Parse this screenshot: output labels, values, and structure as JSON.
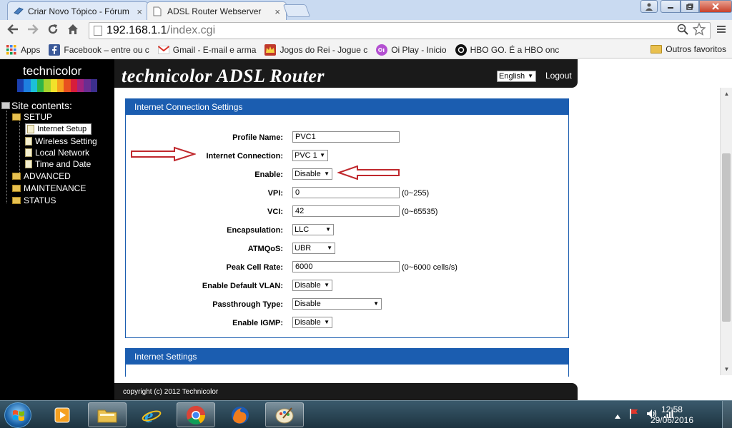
{
  "browser": {
    "tabs": [
      {
        "title": "Criar Novo Tópico - Fórum",
        "active": false
      },
      {
        "title": "ADSL Router Webserver",
        "active": true
      }
    ],
    "close_glyph": "×",
    "address": {
      "host": "192.168.1.1",
      "path": "/index.cgi"
    },
    "bookmarks": [
      {
        "label": "Apps",
        "icon": "apps-grid-icon"
      },
      {
        "label": "Facebook – entre ou c",
        "icon": "facebook-icon"
      },
      {
        "label": "Gmail - E-mail e arma",
        "icon": "gmail-icon"
      },
      {
        "label": "Jogos do Rei - Jogue c",
        "icon": "crown-icon"
      },
      {
        "label": "Oi Play - Inicio",
        "icon": "oi-icon"
      },
      {
        "label": "HBO GO. É a HBO onc",
        "icon": "hbo-icon"
      }
    ],
    "other_bookmarks": "Outros favoritos"
  },
  "router": {
    "logo": "technicolor",
    "brand": "technicolor ADSL Router",
    "language": "English",
    "logout": "Logout",
    "site_contents": "Site contents:",
    "tree": [
      {
        "label": "SETUP",
        "kind": "folder",
        "level": 0
      },
      {
        "label": "Internet Setup",
        "kind": "doc",
        "level": 1,
        "selected": true
      },
      {
        "label": "Wireless Setting",
        "kind": "doc",
        "level": 1
      },
      {
        "label": "Local Network",
        "kind": "doc",
        "level": 1
      },
      {
        "label": "Time and Date",
        "kind": "doc",
        "level": 1
      },
      {
        "label": "ADVANCED",
        "kind": "folder",
        "level": 0
      },
      {
        "label": "MAINTENANCE",
        "kind": "folder",
        "level": 0
      },
      {
        "label": "STATUS",
        "kind": "folder",
        "level": 0
      }
    ],
    "panel1_title": "Internet Connection Settings",
    "panel2_title": "Internet Settings",
    "fields": [
      {
        "label": "Profile Name:",
        "type": "text",
        "value": "PVC1",
        "hint": ""
      },
      {
        "label": "Internet Connection:",
        "type": "select",
        "value": "PVC 1",
        "hint": ""
      },
      {
        "label": "Enable:",
        "type": "select",
        "value": "Disable",
        "hint": ""
      },
      {
        "label": "VPI:",
        "type": "text",
        "value": "0",
        "hint": "(0~255)"
      },
      {
        "label": "VCI:",
        "type": "text",
        "value": "42",
        "hint": "(0~65535)"
      },
      {
        "label": "Encapsulation:",
        "type": "select",
        "value": "LLC",
        "hint": ""
      },
      {
        "label": "ATMQoS:",
        "type": "select",
        "value": "UBR",
        "hint": ""
      },
      {
        "label": "Peak Cell Rate:",
        "type": "text",
        "value": "6000",
        "hint": "(0~6000 cells/s)"
      },
      {
        "label": "Enable Default VLAN:",
        "type": "select",
        "value": "Disable",
        "hint": ""
      },
      {
        "label": "Passthrough Type:",
        "type": "select",
        "value": "Disable",
        "hint": ""
      },
      {
        "label": "Enable IGMP:",
        "type": "select",
        "value": "Disable",
        "hint": ""
      }
    ],
    "footer": "copyright (c) 2012 Technicolor"
  },
  "taskbar": {
    "apps": [
      "media-player-icon",
      "file-explorer-icon",
      "internet-explorer-icon",
      "chrome-icon",
      "firefox-icon",
      "paint-icon"
    ],
    "time": "12:58",
    "date": "29/06/2016"
  },
  "colors": {
    "panel_blue": "#1b5db0",
    "arrow_red": "#c0282d"
  }
}
